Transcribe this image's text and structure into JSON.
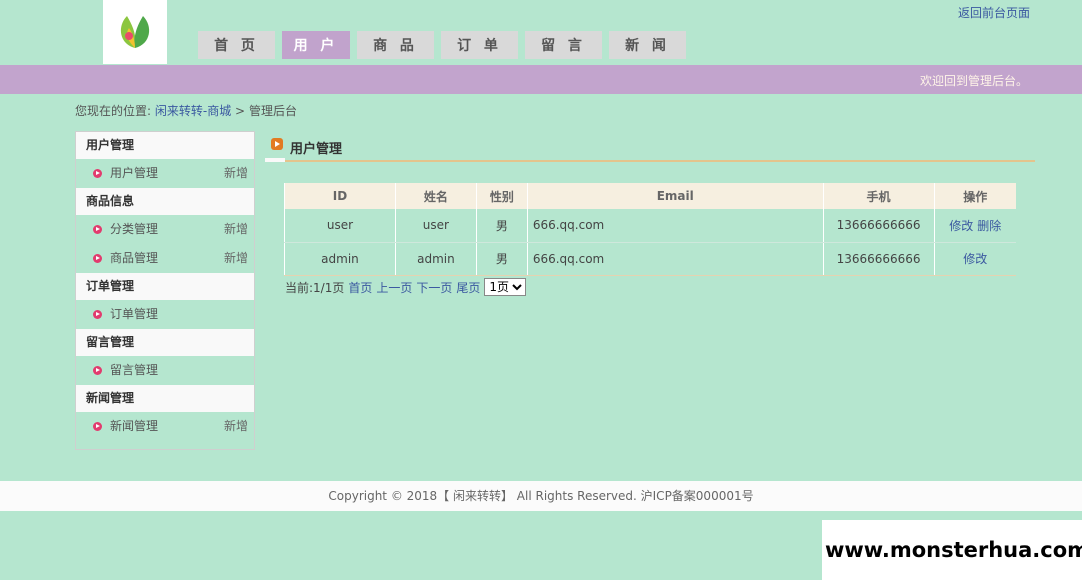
{
  "header": {
    "logo_icon": "leaf-logo-icon",
    "nav": [
      "首 页",
      "用 户",
      "商 品",
      "订 单",
      "留 言",
      "新 闻"
    ],
    "active_nav": 1,
    "front_link": "返回前台页面"
  },
  "welcome": "欢迎回到管理后台。",
  "breadcrumb": {
    "prefix": "您现在的位置:",
    "site": "闲来转转-商城",
    "sep": ">",
    "current": "管理后台"
  },
  "sidebar": {
    "groups": [
      {
        "title": "用户管理",
        "items": [
          {
            "label": "用户管理",
            "add": "新增"
          }
        ]
      },
      {
        "title": "商品信息",
        "items": [
          {
            "label": "分类管理",
            "add": "新增"
          },
          {
            "label": "商品管理",
            "add": "新增"
          }
        ]
      },
      {
        "title": "订单管理",
        "items": [
          {
            "label": "订单管理",
            "add": ""
          }
        ]
      },
      {
        "title": "留言管理",
        "items": [
          {
            "label": "留言管理",
            "add": ""
          }
        ]
      },
      {
        "title": "新闻管理",
        "items": [
          {
            "label": "新闻管理",
            "add": "新增"
          }
        ]
      }
    ]
  },
  "main": {
    "title": "用户管理",
    "table": {
      "columns": [
        "ID",
        "姓名",
        "性别",
        "Email",
        "手机",
        "操作"
      ],
      "rows": [
        {
          "id": "user",
          "name": "user",
          "gender": "男",
          "email": "666.qq.com",
          "phone": "13666666666",
          "actions": [
            "修改",
            "删除"
          ]
        },
        {
          "id": "admin",
          "name": "admin",
          "gender": "男",
          "email": "666.qq.com",
          "phone": "13666666666",
          "actions": [
            "修改"
          ]
        }
      ]
    },
    "pager": {
      "info": "当前:1/1页",
      "first": "首页",
      "prev": "上一页",
      "next": "下一页",
      "last": "尾页",
      "select_value": "1页"
    }
  },
  "footer": "Copyright © 2018【 闲来转转】 All Rights Reserved. 沪ICP备案000001号",
  "watermark": "www.monsterhua.com",
  "colors": {
    "background": "#b5e6cf",
    "accent_purple": "#c2a4cd",
    "link_blue": "#3a58a0",
    "title_underline": "#e4c48c"
  }
}
